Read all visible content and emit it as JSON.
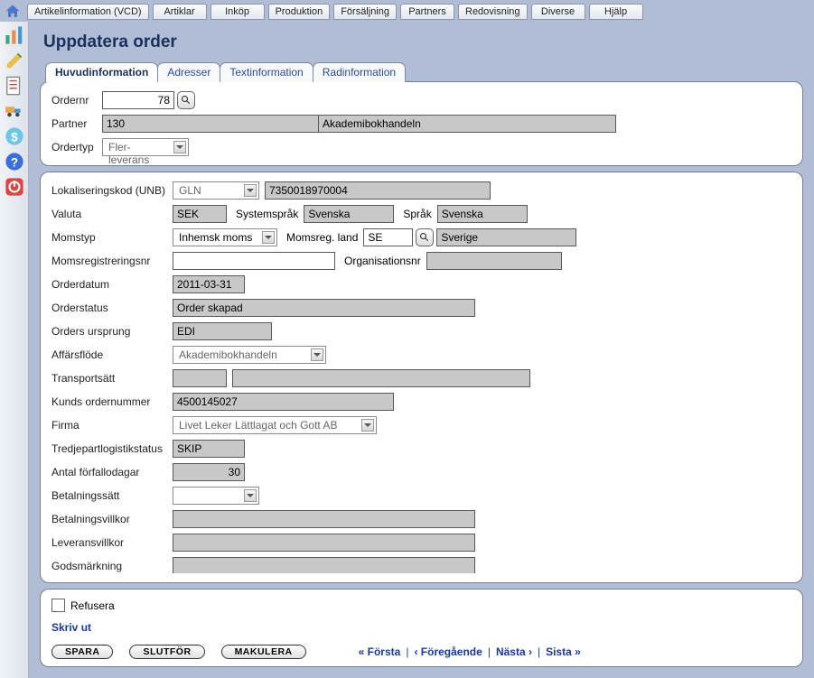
{
  "menu": {
    "items": [
      "Artikelinformation (VCD)",
      "Artiklar",
      "Inköp",
      "Produktion",
      "Försäljning",
      "Partners",
      "Redovisning",
      "Diverse",
      "Hjälp"
    ]
  },
  "page": {
    "title": "Uppdatera order"
  },
  "tabs": {
    "items": [
      "Huvudinformation",
      "Adresser",
      "Textinformation",
      "Radinformation"
    ],
    "active": 0
  },
  "upper": {
    "ordernr_label": "Ordernr",
    "ordernr_value": "78",
    "partner_label": "Partner",
    "partner_code": "130",
    "partner_name": "Akademibokhandeln",
    "ordertyp_label": "Ordertyp",
    "ordertyp_value": "Fler-leverans"
  },
  "form": {
    "lokaliseringskod_label": "Lokaliseringskod (UNB)",
    "lokaliseringskod_type": "GLN",
    "lokaliseringskod_value": "7350018970004",
    "valuta_label": "Valuta",
    "valuta_value": "SEK",
    "systemsprak_label": "Systemspråk",
    "systemsprak_value": "Svenska",
    "sprak_label": "Språk",
    "sprak_value": "Svenska",
    "momstyp_label": "Momstyp",
    "momstyp_value": "Inhemsk moms",
    "momsreg_land_label": "Momsreg. land",
    "momsreg_land_value": "SE",
    "momsreg_land_name": "Sverige",
    "momsregnr_label": "Momsregistreringsnr",
    "momsregnr_value": "",
    "orgnr_label": "Organisationsnr",
    "orgnr_value": "",
    "orderdatum_label": "Orderdatum",
    "orderdatum_value": "2011-03-31",
    "orderstatus_label": "Orderstatus",
    "orderstatus_value": "Order skapad",
    "orders_ursprung_label": "Orders ursprung",
    "orders_ursprung_value": "EDI",
    "affarsflode_label": "Affärsflöde",
    "affarsflode_value": "Akademibokhandeln",
    "transportsatt_label": "Transportsätt",
    "kunds_ordernr_label": "Kunds ordernummer",
    "kunds_ordernr_value": "4500145027",
    "firma_label": "Firma",
    "firma_value": "Livet Leker Lättlagat och Gott AB",
    "tredjepart_label": "Tredjepartlogistikstatus",
    "tredjepart_value": "SKIP",
    "antal_forfall_label": "Antal förfallodagar",
    "antal_forfall_value": "30",
    "betalningssatt_label": "Betalningssätt",
    "betalningsvillkor_label": "Betalningsvillkor",
    "leveransvillkor_label": "Leveransvillkor",
    "godsmarkning_label": "Godsmärkning"
  },
  "bottom": {
    "refusera_label": "Refusera",
    "skriv_ut_label": "Skriv ut",
    "spara": "SPARA",
    "slutfor": "SLUTFÖR",
    "makulera": "MAKULERA",
    "first": "« Första",
    "prev": "‹ Föregående",
    "next": "Nästa ›",
    "last": "Sista »"
  }
}
